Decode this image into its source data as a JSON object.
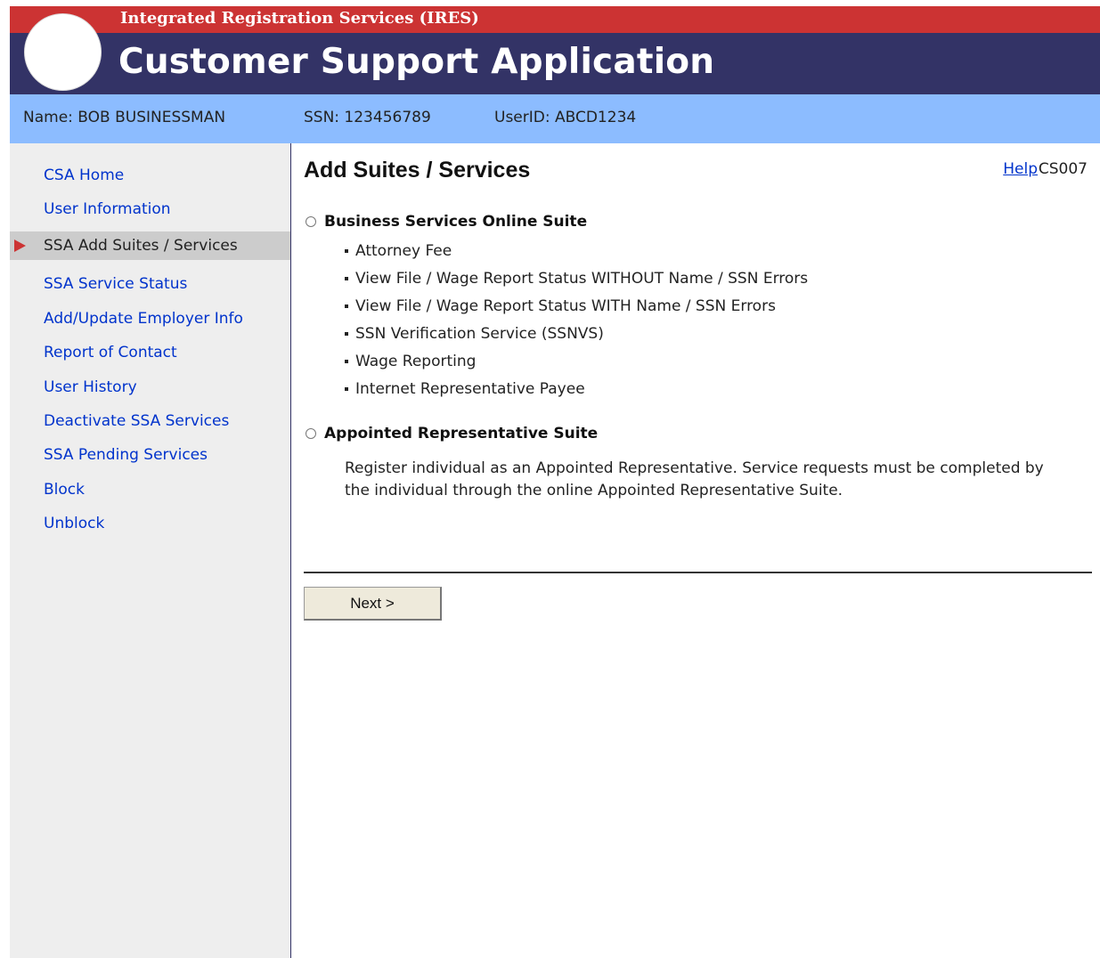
{
  "header": {
    "org_name": "Integrated Registration Services (IRES)",
    "app_title": "Customer Support Application"
  },
  "user_bar": {
    "name": "Name: BOB BUSINESSMAN",
    "ssn": "SSN: 123456789",
    "userid": "UserID: ABCD1234"
  },
  "sidebar": {
    "items": [
      {
        "label": "CSA Home"
      },
      {
        "label": "User Information"
      },
      {
        "label": "SSA Add Suites / Services",
        "active": true
      },
      {
        "label": "SSA Service Status"
      },
      {
        "label": "Add/Update Employer Info"
      },
      {
        "label": "Report of Contact"
      },
      {
        "label": "User History"
      },
      {
        "label": "Deactivate SSA Services"
      },
      {
        "label": "SSA Pending Services"
      },
      {
        "label": "Block"
      },
      {
        "label": "Unblock"
      }
    ]
  },
  "main": {
    "title": "Add Suites / Services",
    "help_label": "Help",
    "screen_code": "CS007",
    "options": [
      {
        "label": "Business Services Online Suite",
        "selected": false,
        "services": [
          "Attorney Fee",
          "View File / Wage Report Status WITHOUT Name / SSN Errors",
          "View File / Wage Report Status WITH Name / SSN Errors",
          "SSN Verification Service (SSNVS)",
          "Wage Reporting",
          "Internet Representative Payee"
        ]
      },
      {
        "label": "Appointed Representative Suite",
        "selected": false,
        "description": "Register individual as an Appointed Representative. Service requests must be completed by the individual through the online Appointed Representative Suite."
      }
    ],
    "next_label": "Next >"
  },
  "colors": {
    "top_bar": "#cc3333",
    "title_bar": "#333366",
    "user_bar": "#8cbcff",
    "sidebar_bg": "#eeeeee",
    "link": "#0033cc",
    "active_arrow": "#cc3333"
  },
  "icons": {
    "active_marker": "triangle-right-icon",
    "logo": "circle-logo"
  }
}
